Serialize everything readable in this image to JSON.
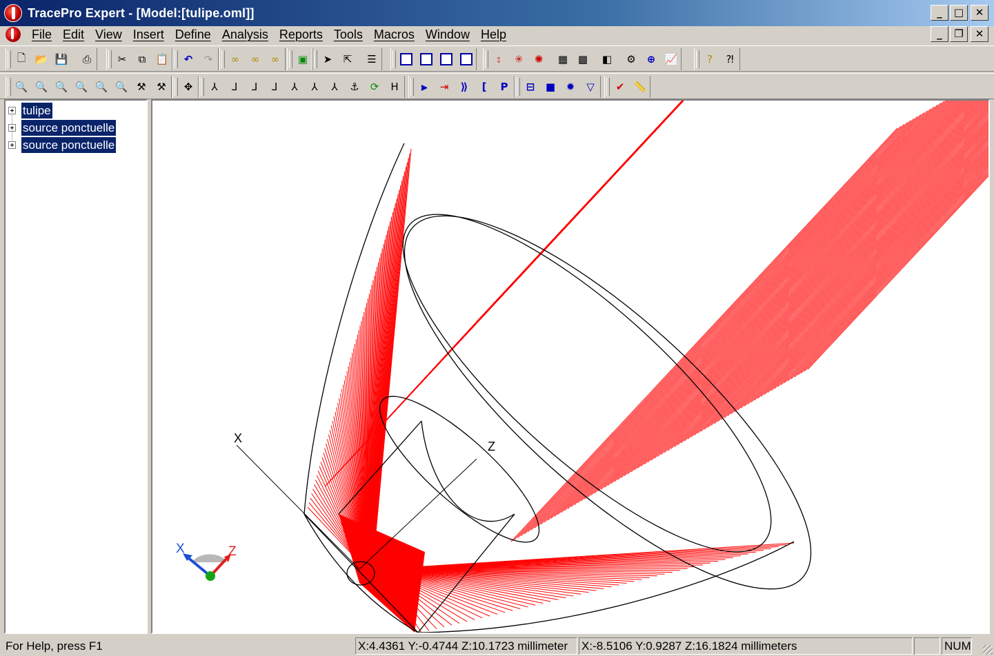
{
  "window": {
    "title": "TracePro Expert - [Model:[tulipe.oml]]",
    "controls": [
      "minimize-icon",
      "maximize-icon",
      "close-icon"
    ],
    "mdi_controls": [
      "minimize-icon",
      "restore-icon",
      "close-icon"
    ]
  },
  "menu": [
    "File",
    "Edit",
    "View",
    "Insert",
    "Define",
    "Analysis",
    "Reports",
    "Tools",
    "Macros",
    "Window",
    "Help"
  ],
  "toolbar1": {
    "groups": [
      [
        "new-file-icon",
        "open-folder-icon",
        "save-icon",
        "print-icon"
      ],
      [
        "cut-icon",
        "copy-icon",
        "paste-icon"
      ],
      [
        "undo-icon",
        "redo-icon"
      ],
      [
        "boolean-union-icon",
        "boolean-intersect-icon",
        "boolean-subtract-icon"
      ],
      [
        "solid-object-icon"
      ],
      [
        "select-arrow-icon",
        "select-surface-icon"
      ],
      [
        "notes-icon"
      ],
      [
        "window-single-icon",
        "window-cascade-icon",
        "window-tile-horizontal-icon",
        "window-tile-vertical-icon"
      ],
      [
        "raytrace-icon",
        "source-icon",
        "raytrace-new-icon",
        "grid-table-icon",
        "map-icon",
        "report-icon",
        "settings-icon",
        "target-icon",
        "chart-icon"
      ],
      [
        "help-icon",
        "context-help-icon"
      ]
    ]
  },
  "toolbar2": {
    "groups": [
      [
        "zoom-in-icon",
        "zoom-out-icon",
        "zoom-window-icon",
        "zoom-fit-icon",
        "zoom-all-icon",
        "zoom-previous-icon",
        "view-options-icon",
        "view-reset-icon"
      ],
      [
        "pan-icon"
      ],
      [
        "view-xy-icon",
        "view-yz-icon",
        "view-xz-icon",
        "view-yx-icon",
        "view-zy-icon",
        "view-zx-icon",
        "view-iso-icon",
        "view-dimetric-icon",
        "rotate-icon",
        "hidden-line-icon"
      ],
      [
        "trace-forward-icon",
        "trace-to-icon",
        "trace-project-icon",
        "bracket-icon",
        "property-icon"
      ],
      [
        "surface-icon",
        "solid-icon",
        "sphere-icon",
        "cone-icon"
      ],
      [
        "check-icon",
        "ruler-icon"
      ]
    ]
  },
  "tree": {
    "items": [
      "tulipe",
      "source ponctuelle",
      "source ponctuelle"
    ]
  },
  "viewport": {
    "axis_labels": {
      "x": "X",
      "z": "Z"
    },
    "triad_labels": {
      "x": "X",
      "z": "Z"
    },
    "colors": {
      "rays": "#ff0000",
      "geometry": "#000000",
      "triad_x": "#1a4fd6",
      "triad_z": "#e02020",
      "triad_y": "#16a416"
    }
  },
  "status": {
    "help": "For Help, press F1",
    "coord1": "X:4.4361 Y:-0.4744 Z:10.1723 millimeter",
    "coord2": "X:-8.5106 Y:0.9287 Z:16.1824 millimeters",
    "num": "NUM"
  }
}
